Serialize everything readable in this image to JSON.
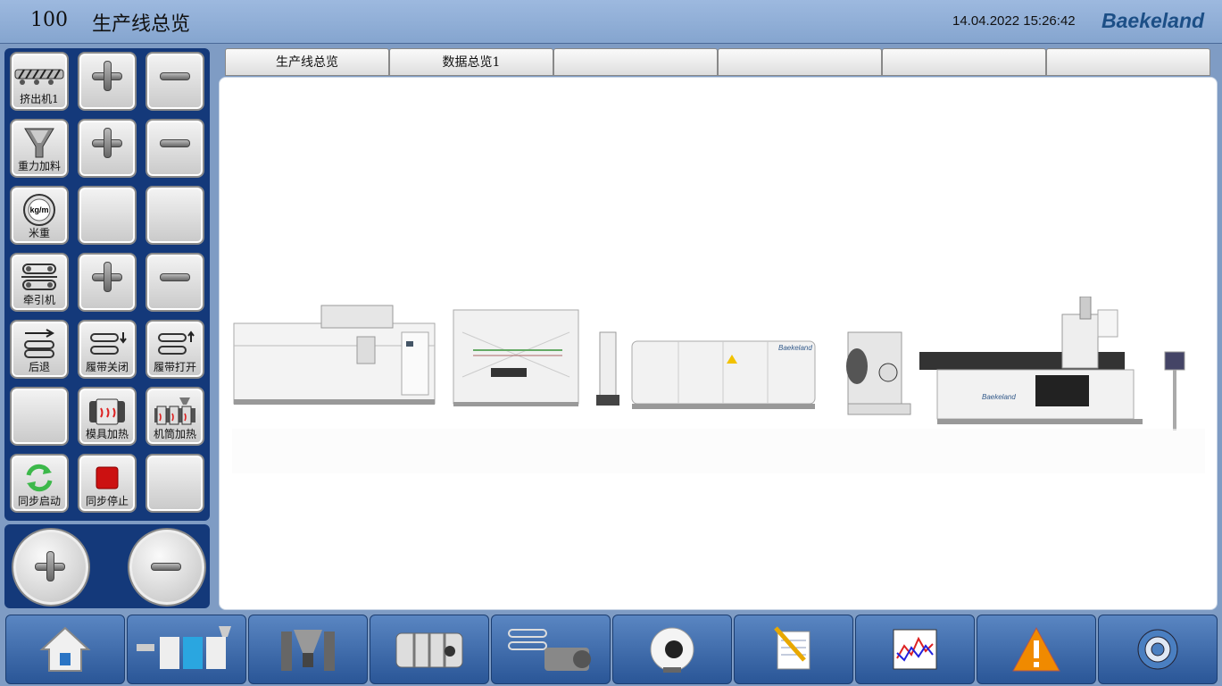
{
  "header": {
    "number": "100",
    "title": "生产线总览",
    "datetime": "14.04.2022 15:26:42",
    "brand": "Baekeland"
  },
  "tabs": [
    "生产线总览",
    "数据总览1",
    "",
    "",
    "",
    ""
  ],
  "left_buttons": {
    "extruder": "挤出机1",
    "gravity_feed": "重力加料",
    "meter_weight": "米重",
    "haul_off": "牵引机",
    "retreat": "后退",
    "track_close": "履带关闭",
    "track_open": "履带打开",
    "die_heating": "模具加热",
    "barrel_heating": "机筒加热",
    "sync_start": "同步启动",
    "sync_stop": "同步停止"
  },
  "machine_logo": "Baekeland",
  "nav_icons": [
    "home-icon",
    "production-line-icon",
    "feeder-icon",
    "die-head-icon",
    "haul-off-motor-icon",
    "cutter-icon",
    "notes-icon",
    "trend-chart-icon",
    "alarm-icon",
    "settings-icon"
  ]
}
